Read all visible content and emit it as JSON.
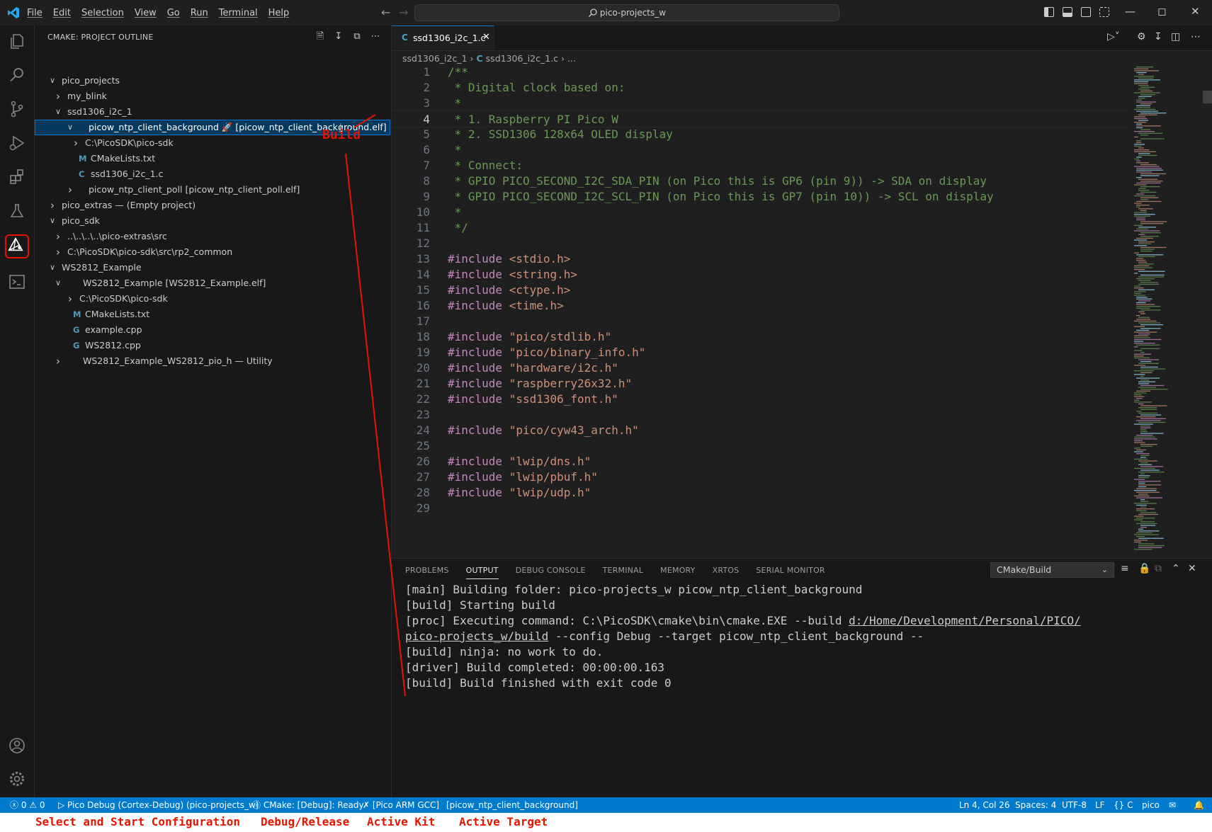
{
  "titlebar": {
    "menus": [
      "File",
      "Edit",
      "Selection",
      "View",
      "Go",
      "Run",
      "Terminal",
      "Help"
    ],
    "search_text": "pico-projects_w"
  },
  "sidebar": {
    "title": "CMAKE: PROJECT OUTLINE",
    "tree": [
      {
        "label": "pico_projects",
        "depth": 0,
        "expanded": true
      },
      {
        "label": "my_blink",
        "depth": 1,
        "expanded": false
      },
      {
        "label": "ssd1306_i2c_1",
        "depth": 1,
        "expanded": true
      },
      {
        "label": "picow_ntp_client_background 🚀 [picow_ntp_client_background.elf]",
        "depth": 2,
        "expanded": true,
        "selected": true
      },
      {
        "label": "C:\\PicoSDK\\pico-sdk",
        "depth": 3,
        "expanded": false
      },
      {
        "label": "CMakeLists.txt",
        "depth": 3,
        "icon": "M"
      },
      {
        "label": "ssd1306_i2c_1.c",
        "depth": 3,
        "icon": "C"
      },
      {
        "label": "picow_ntp_client_poll [picow_ntp_client_poll.elf]",
        "depth": 2,
        "expanded": false
      },
      {
        "label": "pico_extras — (Empty project)",
        "depth": 0,
        "expanded": false
      },
      {
        "label": "pico_sdk",
        "depth": 0,
        "expanded": true
      },
      {
        "label": "..\\..\\..\\..\\pico-extras\\src",
        "depth": 1,
        "expanded": false
      },
      {
        "label": "C:\\PicoSDK\\pico-sdk\\src\\rp2_common",
        "depth": 1,
        "expanded": false
      },
      {
        "label": "WS2812_Example",
        "depth": 0,
        "expanded": true
      },
      {
        "label": "WS2812_Example [WS2812_Example.elf]",
        "depth": 1,
        "expanded": true
      },
      {
        "label": "C:\\PicoSDK\\pico-sdk",
        "depth": 2,
        "expanded": false
      },
      {
        "label": "CMakeLists.txt",
        "depth": 2,
        "icon": "M"
      },
      {
        "label": "example.cpp",
        "depth": 2,
        "icon": "C++"
      },
      {
        "label": "WS2812.cpp",
        "depth": 2,
        "icon": "C++"
      },
      {
        "label": "WS2812_Example_WS2812_pio_h — Utility",
        "depth": 1,
        "expanded": false
      }
    ]
  },
  "editor": {
    "tab_label": "ssd1306_i2c_1.c",
    "tab_icon": "C",
    "breadcrumb": {
      "folder": "ssd1306_i2c_1",
      "file": "ssd1306_i2c_1.c",
      "tail": "..."
    },
    "current_line": 4,
    "lines": [
      {
        "n": "1",
        "t": "/**",
        "k": "cmt"
      },
      {
        "n": "2",
        "t": " * Digital clock based on:",
        "k": "cmt"
      },
      {
        "n": "3",
        "t": " *",
        "k": "cmt"
      },
      {
        "n": "4",
        "t": " * 1. Raspberry PI Pico W",
        "k": "cmt"
      },
      {
        "n": "5",
        "t": " * 2. SSD1306 128x64 OLED display",
        "k": "cmt"
      },
      {
        "n": "6",
        "t": " *",
        "k": "cmt"
      },
      {
        "n": "7",
        "t": " * Connect:",
        "k": "cmt"
      },
      {
        "n": "8",
        "t": " * GPIO PICO_SECOND_I2C_SDA_PIN (on Pico this is GP6 (pin 9)) -> SDA on display",
        "k": "cmt"
      },
      {
        "n": "9",
        "t": " * GPIO PICO_SECOND_I2C_SCL_PIN (on Pico this is GP7 (pin 10)) -> SCL on display",
        "k": "cmt"
      },
      {
        "n": "10",
        "t": " *",
        "k": "cmt"
      },
      {
        "n": "11",
        "t": " */",
        "k": "cmt"
      },
      {
        "n": "12",
        "t": "",
        "k": "cmt"
      },
      {
        "n": "13",
        "t": "<stdio.h>",
        "k": "inc"
      },
      {
        "n": "14",
        "t": "<string.h>",
        "k": "inc"
      },
      {
        "n": "15",
        "t": "<ctype.h>",
        "k": "inc"
      },
      {
        "n": "16",
        "t": "<time.h>",
        "k": "inc"
      },
      {
        "n": "17",
        "t": "",
        "k": "cmt"
      },
      {
        "n": "18",
        "t": "\"pico/stdlib.h\"",
        "k": "inc"
      },
      {
        "n": "19",
        "t": "\"pico/binary_info.h\"",
        "k": "inc"
      },
      {
        "n": "20",
        "t": "\"hardware/i2c.h\"",
        "k": "inc"
      },
      {
        "n": "21",
        "t": "\"raspberry26x32.h\"",
        "k": "inc"
      },
      {
        "n": "22",
        "t": "\"ssd1306_font.h\"",
        "k": "inc"
      },
      {
        "n": "23",
        "t": "",
        "k": "cmt"
      },
      {
        "n": "24",
        "t": "\"pico/cyw43_arch.h\"",
        "k": "inc"
      },
      {
        "n": "25",
        "t": "",
        "k": "cmt"
      },
      {
        "n": "26",
        "t": "\"lwip/dns.h\"",
        "k": "inc"
      },
      {
        "n": "27",
        "t": "\"lwip/pbuf.h\"",
        "k": "inc"
      },
      {
        "n": "28",
        "t": "\"lwip/udp.h\"",
        "k": "inc"
      },
      {
        "n": "29",
        "t": "",
        "k": "cmt"
      }
    ],
    "include_keyword": "#include"
  },
  "panel": {
    "tabs": [
      "PROBLEMS",
      "OUTPUT",
      "DEBUG CONSOLE",
      "TERMINAL",
      "MEMORY",
      "XRTOS",
      "SERIAL MONITOR"
    ],
    "active_tab": "OUTPUT",
    "channel": "CMake/Build",
    "output": {
      "l1": "[main] Building folder: pico-projects_w picow_ntp_client_background",
      "l2": "[build] Starting build",
      "l3a": "[proc] Executing command: C:\\PicoSDK\\cmake\\bin\\cmake.EXE --build ",
      "l3b": "d:/Home/Development/Personal/PICO/",
      "l4a": "pico-projects_w/build",
      "l4b": " --config Debug --target picow_ntp_client_background --",
      "l5": "[build] ninja: no work to do.",
      "l6": "[driver] Build completed: 00:00:00.163",
      "l7": "[build] Build finished with exit code 0"
    }
  },
  "statusbar": {
    "problems": "ⓧ 0 ⚠ 0",
    "debug": "Pico Debug (Cortex-Debug) (pico-projects_w)",
    "cmake": "CMake: [Debug]: Ready",
    "kit": "[Pico ARM GCC]",
    "target": "[picow_ntp_client_background]",
    "position": "Ln 4, Col 26",
    "spaces": "Spaces: 4",
    "encoding": "UTF-8",
    "eol": "LF",
    "language": "{} C",
    "profile": "pico"
  },
  "annotations": {
    "build": "Build",
    "select_start": "Select and Start Configuration",
    "debug_release": "Debug/Release",
    "active_kit": "Active Kit",
    "active_target": "Active Target"
  },
  "colors": {
    "accent": "#007acc",
    "annotation": "#e51400",
    "comment": "#6a9955",
    "keyword": "#c586c0",
    "string": "#ce9178"
  }
}
